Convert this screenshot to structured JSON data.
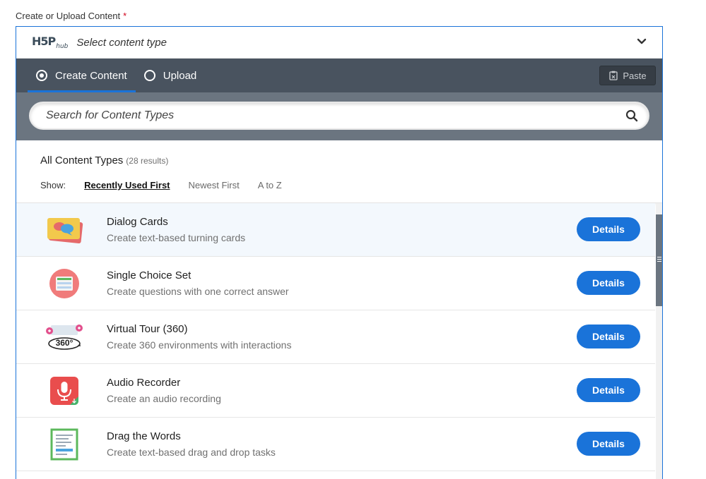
{
  "field": {
    "label": "Create or Upload Content",
    "required_mark": "*"
  },
  "hub": {
    "logo": "H5P",
    "logo_sub": "hub",
    "title": "Select content type"
  },
  "tabs": [
    {
      "label": "Create Content",
      "selected": true
    },
    {
      "label": "Upload",
      "selected": false
    }
  ],
  "paste": {
    "label": "Paste"
  },
  "search": {
    "placeholder": "Search for Content Types"
  },
  "results": {
    "title": "All Content Types",
    "count": "(28 results)",
    "show_label": "Show:",
    "sort_options": [
      "Recently Used First",
      "Newest First",
      "A to Z"
    ],
    "active_sort": "Recently Used First"
  },
  "items": [
    {
      "title": "Dialog Cards",
      "desc": "Create text-based turning cards",
      "icon": "dialog-cards-icon",
      "button": "Details"
    },
    {
      "title": "Single Choice Set",
      "desc": "Create questions with one correct answer",
      "icon": "single-choice-set-icon",
      "button": "Details"
    },
    {
      "title": "Virtual Tour (360)",
      "desc": "Create 360 environments with interactions",
      "icon": "virtual-tour-360-icon",
      "button": "Details",
      "icon_text": "360°"
    },
    {
      "title": "Audio Recorder",
      "desc": "Create an audio recording",
      "icon": "audio-recorder-icon",
      "button": "Details"
    },
    {
      "title": "Drag the Words",
      "desc": "Create text-based drag and drop tasks",
      "icon": "drag-the-words-icon",
      "button": "Details"
    }
  ],
  "colors": {
    "accent": "#1a73d9",
    "tab_bar": "#49535f",
    "search_bar": "#6b7580",
    "required": "#d0021b"
  }
}
